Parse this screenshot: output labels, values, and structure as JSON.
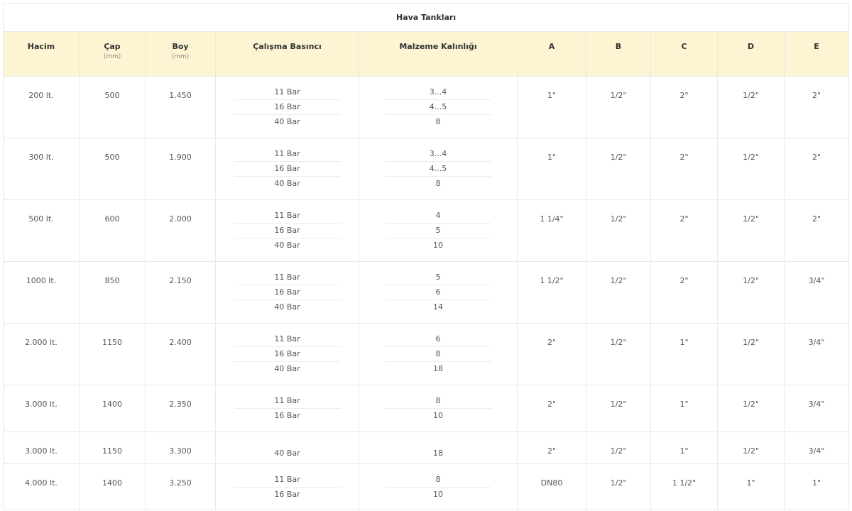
{
  "table": {
    "title": "Hava Tankları",
    "headers": [
      {
        "label": "Hacim",
        "unit": ""
      },
      {
        "label": "Çap",
        "unit": "(mm)"
      },
      {
        "label": "Boy",
        "unit": "(mm)"
      },
      {
        "label": "Çalışma Basıncı",
        "unit": ""
      },
      {
        "label": "Malzeme Kalınlığı",
        "unit": ""
      },
      {
        "label": "A",
        "unit": ""
      },
      {
        "label": "B",
        "unit": ""
      },
      {
        "label": "C",
        "unit": ""
      },
      {
        "label": "D",
        "unit": ""
      },
      {
        "label": "E",
        "unit": ""
      }
    ],
    "rows": [
      {
        "hacim": "200 lt.",
        "cap": "500",
        "boy": "1.450",
        "basinc": [
          "11 Bar",
          "16 Bar",
          "40 Bar"
        ],
        "kalinlik": [
          "3...4",
          "4...5",
          "8"
        ],
        "a": "1\"",
        "b": "1/2\"",
        "c": "2\"",
        "d": "1/2\"",
        "e": "2\""
      },
      {
        "hacim": "300 lt.",
        "cap": "500",
        "boy": "1.900",
        "basinc": [
          "11 Bar",
          "16 Bar",
          "40 Bar"
        ],
        "kalinlik": [
          "3...4",
          "4...5",
          "8"
        ],
        "a": "1\"",
        "b": "1/2\"",
        "c": "2\"",
        "d": "1/2\"",
        "e": "2\""
      },
      {
        "hacim": "500 lt.",
        "cap": "600",
        "boy": "2.000",
        "basinc": [
          "11 Bar",
          "16 Bar",
          "40 Bar"
        ],
        "kalinlik": [
          "4",
          "5",
          "10"
        ],
        "a": "1 1/4\"",
        "b": "1/2\"",
        "c": "2\"",
        "d": "1/2\"",
        "e": "2\""
      },
      {
        "hacim": "1000 lt.",
        "cap": "850",
        "boy": "2.150",
        "basinc": [
          "11 Bar",
          "16 Bar",
          "40 Bar"
        ],
        "kalinlik": [
          "5",
          "6",
          "14"
        ],
        "a": "1 1/2\"",
        "b": "1/2\"",
        "c": "2\"",
        "d": "1/2\"",
        "e": "3/4\""
      },
      {
        "hacim": "2.000 lt.",
        "cap": "1150",
        "boy": "2.400",
        "basinc": [
          "11 Bar",
          "16 Bar",
          "40 Bar"
        ],
        "kalinlik": [
          "6",
          "8",
          "18"
        ],
        "a": "2\"",
        "b": "1/2\"",
        "c": "1\"",
        "d": "1/2\"",
        "e": "3/4\""
      },
      {
        "hacim": "3.000 lt.",
        "cap": "1400",
        "boy": "2.350",
        "basinc": [
          "11 Bar",
          "16 Bar"
        ],
        "kalinlik": [
          "8",
          "10"
        ],
        "a": "2\"",
        "b": "1/2\"",
        "c": "1\"",
        "d": "1/2\"",
        "e": "3/4\""
      },
      {
        "hacim": "3.000 lt.",
        "cap": "1150",
        "boy": "3.300",
        "basinc": [
          "40 Bar"
        ],
        "kalinlik": [
          "18"
        ],
        "a": "2\"",
        "b": "1/2\"",
        "c": "1\"",
        "d": "1/2\"",
        "e": "3/4\""
      },
      {
        "hacim": "4.000 lt.",
        "cap": "1400",
        "boy": "3.250",
        "basinc": [
          "11 Bar",
          "16 Bar"
        ],
        "kalinlik": [
          "8",
          "10"
        ],
        "a": "DN80",
        "b": "1/2\"",
        "c": "1 1/2\"",
        "d": "1\"",
        "e": "1\""
      }
    ]
  }
}
